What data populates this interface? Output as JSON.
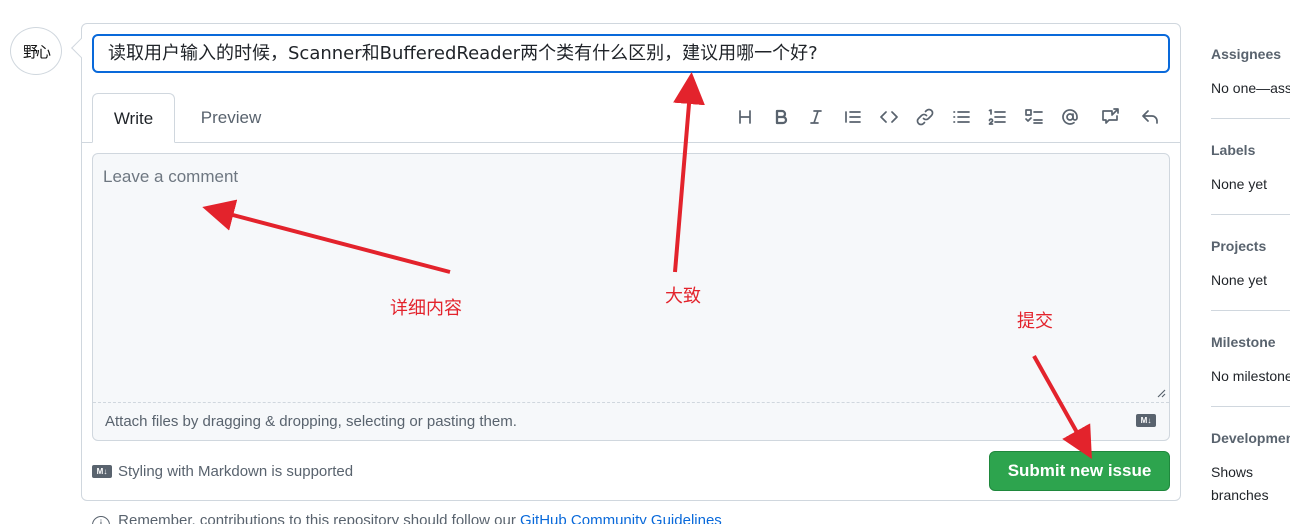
{
  "avatar": {
    "text": "野心"
  },
  "issue_form": {
    "title_value": "读取用户输入的时候，Scanner和BufferedReader两个类有什么区别，建议用哪一个好?",
    "tabs": [
      {
        "label": "Write"
      },
      {
        "label": "Preview"
      }
    ],
    "toolbar_icons": [
      "heading-icon",
      "bold-icon",
      "italic-icon",
      "quote-icon",
      "code-icon",
      "link-icon",
      "bulleted-list-icon",
      "numbered-list-icon",
      "task-list-icon",
      "mention-icon",
      "cross-reference-icon",
      "reply-icon"
    ],
    "comment_placeholder": "Leave a comment",
    "attach_text": "Attach files by dragging & dropping, selecting or pasting them.",
    "markdown_badge": "M↓",
    "markdown_note": "Styling with Markdown is supported",
    "submit_label": "Submit new issue",
    "footer_note": "Remember, contributions to this repository should follow our",
    "footer_link": "GitHub Community Guidelines"
  },
  "sidebar": {
    "sections": [
      {
        "heading": "Assignees",
        "value": "No one—assign yourself"
      },
      {
        "heading": "Labels",
        "value": "None yet"
      },
      {
        "heading": "Projects",
        "value": "None yet"
      },
      {
        "heading": "Milestone",
        "value": "No milestone"
      },
      {
        "heading": "Development",
        "value": "Shows branches and pull requests linked to this issue."
      }
    ]
  },
  "annotations": {
    "detail": "详细内容",
    "summary": "大致",
    "submit": "提交",
    "color": "#e3232c"
  },
  "colors": {
    "accent": "#0969da",
    "submit_green": "#2da44e"
  }
}
